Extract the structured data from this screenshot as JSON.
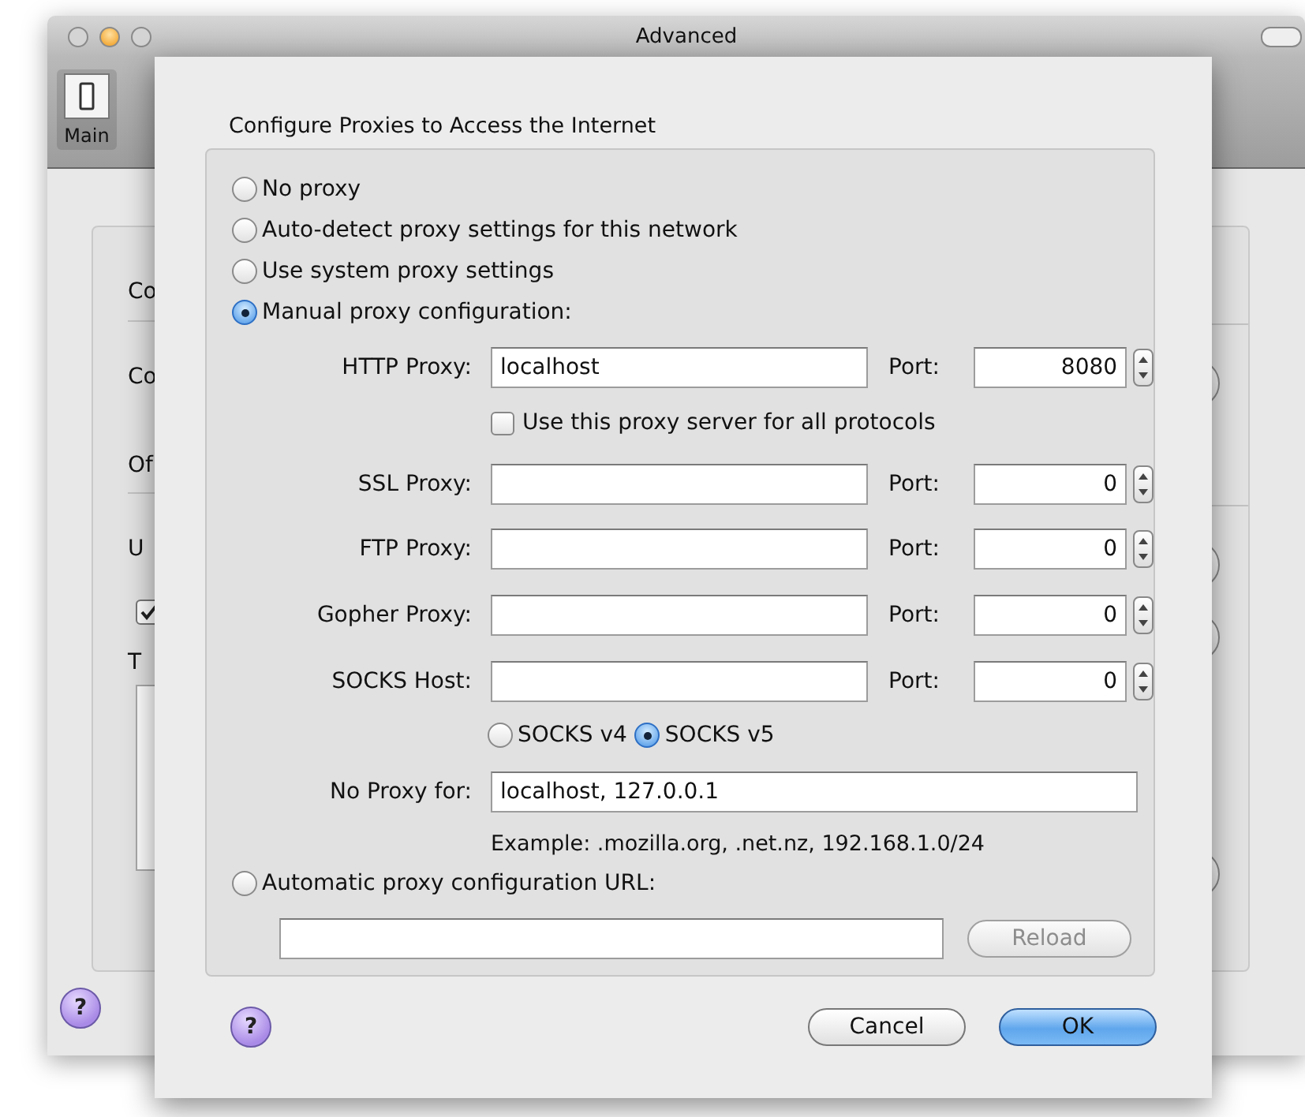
{
  "window": {
    "title": "Advanced",
    "toolbar": [
      {
        "label": "Main",
        "selected": true
      }
    ],
    "background_labels": [
      "Co",
      "Co",
      "Of",
      "U",
      "T"
    ],
    "background_checkbox": {
      "checked": true
    },
    "help": "?"
  },
  "sheet": {
    "title": "Configure Proxies to Access the Internet",
    "modes": [
      {
        "label": "No proxy",
        "selected": false
      },
      {
        "label": "Auto-detect proxy settings for this network",
        "selected": false
      },
      {
        "label": "Use system proxy settings",
        "selected": false
      },
      {
        "label": "Manual proxy configuration:",
        "selected": true
      }
    ],
    "http": {
      "label": "HTTP Proxy:",
      "value": "localhost",
      "port_label": "Port:",
      "port": "8080"
    },
    "share_all": {
      "label": "Use this proxy server for all protocols",
      "checked": false
    },
    "proxies": [
      {
        "label": "SSL Proxy:",
        "port_label": "Port:",
        "port": "0"
      },
      {
        "label": "FTP Proxy:",
        "port_label": "Port:",
        "port": "0"
      },
      {
        "label": "Gopher Proxy:",
        "port_label": "Port:",
        "port": "0"
      },
      {
        "label": "SOCKS Host:",
        "port_label": "Port:",
        "port": "0"
      }
    ],
    "socks_versions": [
      {
        "label": "SOCKS v4",
        "selected": false
      },
      {
        "label": "SOCKS v5",
        "selected": true
      }
    ],
    "no_proxy": {
      "label": "No Proxy for:",
      "value": "localhost, 127.0.0.1"
    },
    "example": "Example: .mozilla.org, .net.nz, 192.168.1.0/24",
    "auto": {
      "label": "Automatic proxy configuration URL:",
      "selected": false
    },
    "reload": {
      "label": "Reload",
      "disabled": true
    },
    "help": "?",
    "buttons": [
      {
        "label": "Cancel",
        "kind": "secondary"
      },
      {
        "label": "OK",
        "kind": "default"
      }
    ]
  }
}
